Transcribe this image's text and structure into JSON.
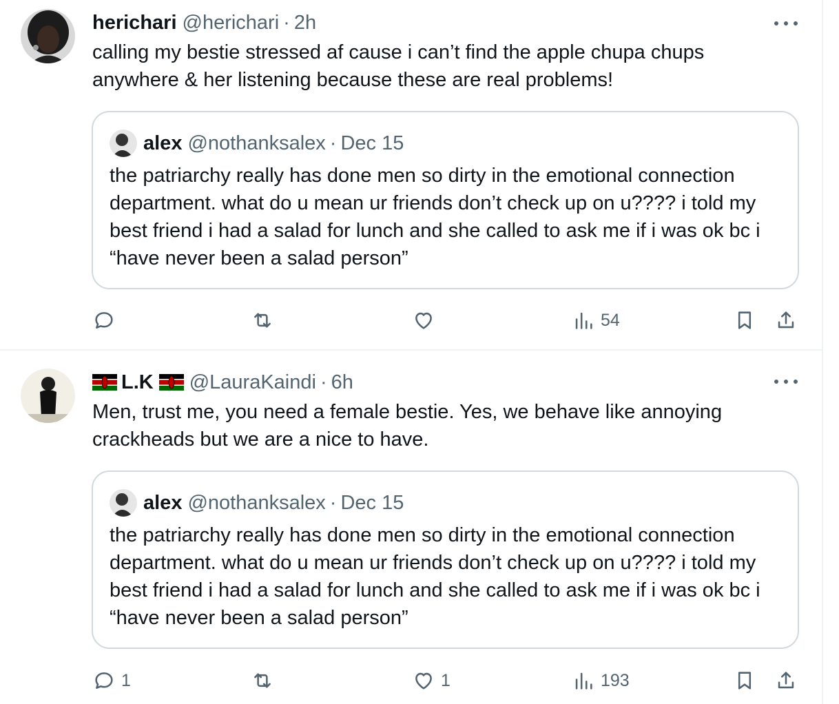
{
  "tweets": [
    {
      "author": {
        "name": "herichari",
        "handle": "@herichari",
        "time": "2h"
      },
      "text": "calling my bestie stressed af cause i can’t find the apple chupa chups anywhere & her listening because these are real problems!",
      "quote": {
        "author": {
          "name": "alex",
          "handle": "@nothanksalex",
          "time": "Dec 15"
        },
        "text": "the patriarchy really has done men so dirty in the emotional connection department. what do u mean ur friends don’t check up on u???? i told my best friend i had a salad for lunch and she called to ask me if i was ok bc i “have never been a salad person”"
      },
      "stats": {
        "replies": "",
        "reposts": "",
        "likes": "",
        "views": "54"
      }
    },
    {
      "author": {
        "name": "L.K",
        "handle": "@LauraKaindi",
        "time": "6h",
        "flag_icon": "kenya-flag-icon"
      },
      "text": "Men, trust me, you need a female bestie. Yes, we behave like annoying crackheads but we are a nice to have.",
      "quote": {
        "author": {
          "name": "alex",
          "handle": "@nothanksalex",
          "time": "Dec 15"
        },
        "text": "the patriarchy really has done men so dirty in the emotional connection department. what do u mean ur friends don’t check up on u???? i told my best friend i had a salad for lunch and she called to ask me if i was ok bc i “have never been a salad person”"
      },
      "stats": {
        "replies": "1",
        "reposts": "",
        "likes": "1",
        "views": "193"
      }
    }
  ],
  "separator": "·",
  "colors": {
    "text": "#0f1419",
    "secondary": "#536471",
    "border": "#cfd9de",
    "divider": "#eff3f4"
  },
  "icons": {
    "reply": "reply-icon",
    "repost": "repost-icon",
    "like": "heart-icon",
    "views": "views-icon",
    "bookmark": "bookmark-icon",
    "share": "share-icon",
    "more": "more-icon"
  }
}
